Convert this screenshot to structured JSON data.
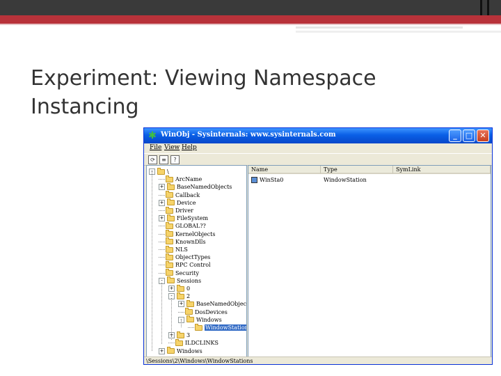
{
  "slide": {
    "title": "Experiment: Viewing Namespace Instancing"
  },
  "window": {
    "title": "WinObj - Sysinternals: www.sysinternals.com",
    "app_icon": "gear-icon",
    "buttons": {
      "minimize": "_",
      "maximize": "□",
      "close": "✕"
    }
  },
  "menu": {
    "items": [
      "File",
      "View",
      "Help"
    ]
  },
  "toolbar": {
    "buttons": [
      "refresh",
      "properties",
      "help"
    ]
  },
  "tree": {
    "root_label": "\\",
    "items": [
      {
        "label": "\\",
        "expander": "-",
        "selected": false
      },
      {
        "label": "ArcName",
        "expander": "",
        "selected": false
      },
      {
        "label": "BaseNamedObjects",
        "expander": "+",
        "selected": false
      },
      {
        "label": "Callback",
        "expander": "",
        "selected": false
      },
      {
        "label": "Device",
        "expander": "+",
        "selected": false
      },
      {
        "label": "Driver",
        "expander": "",
        "selected": false
      },
      {
        "label": "FileSystem",
        "expander": "+",
        "selected": false
      },
      {
        "label": "GLOBAL??",
        "expander": "",
        "selected": false
      },
      {
        "label": "KernelObjects",
        "expander": "",
        "selected": false
      },
      {
        "label": "KnownDlls",
        "expander": "",
        "selected": false
      },
      {
        "label": "NLS",
        "expander": "",
        "selected": false
      },
      {
        "label": "ObjectTypes",
        "expander": "",
        "selected": false
      },
      {
        "label": "RPC Control",
        "expander": "",
        "selected": false
      },
      {
        "label": "Security",
        "expander": "",
        "selected": false
      },
      {
        "label": "Sessions",
        "expander": "-",
        "selected": false
      },
      {
        "label": "0",
        "expander": "+",
        "selected": false
      },
      {
        "label": "2",
        "expander": "-",
        "selected": false
      },
      {
        "label": "BaseNamedObjects",
        "expander": "+",
        "selected": false
      },
      {
        "label": "DosDevices",
        "expander": "",
        "selected": false
      },
      {
        "label": "Windows",
        "expander": "-",
        "selected": false
      },
      {
        "label": "WindowStations",
        "expander": "",
        "selected": true
      },
      {
        "label": "3",
        "expander": "+",
        "selected": false
      },
      {
        "label": "ILDCLINKS",
        "expander": "",
        "selected": false
      },
      {
        "label": "Windows",
        "expander": "+",
        "selected": false
      }
    ]
  },
  "list": {
    "columns": [
      "Name",
      "Type",
      "SymLink"
    ],
    "rows": [
      {
        "name": "WinSta0",
        "type": "WindowStation",
        "symlink": ""
      }
    ]
  },
  "status": {
    "path": "\\Sessions\\2\\Windows\\WindowStations"
  }
}
